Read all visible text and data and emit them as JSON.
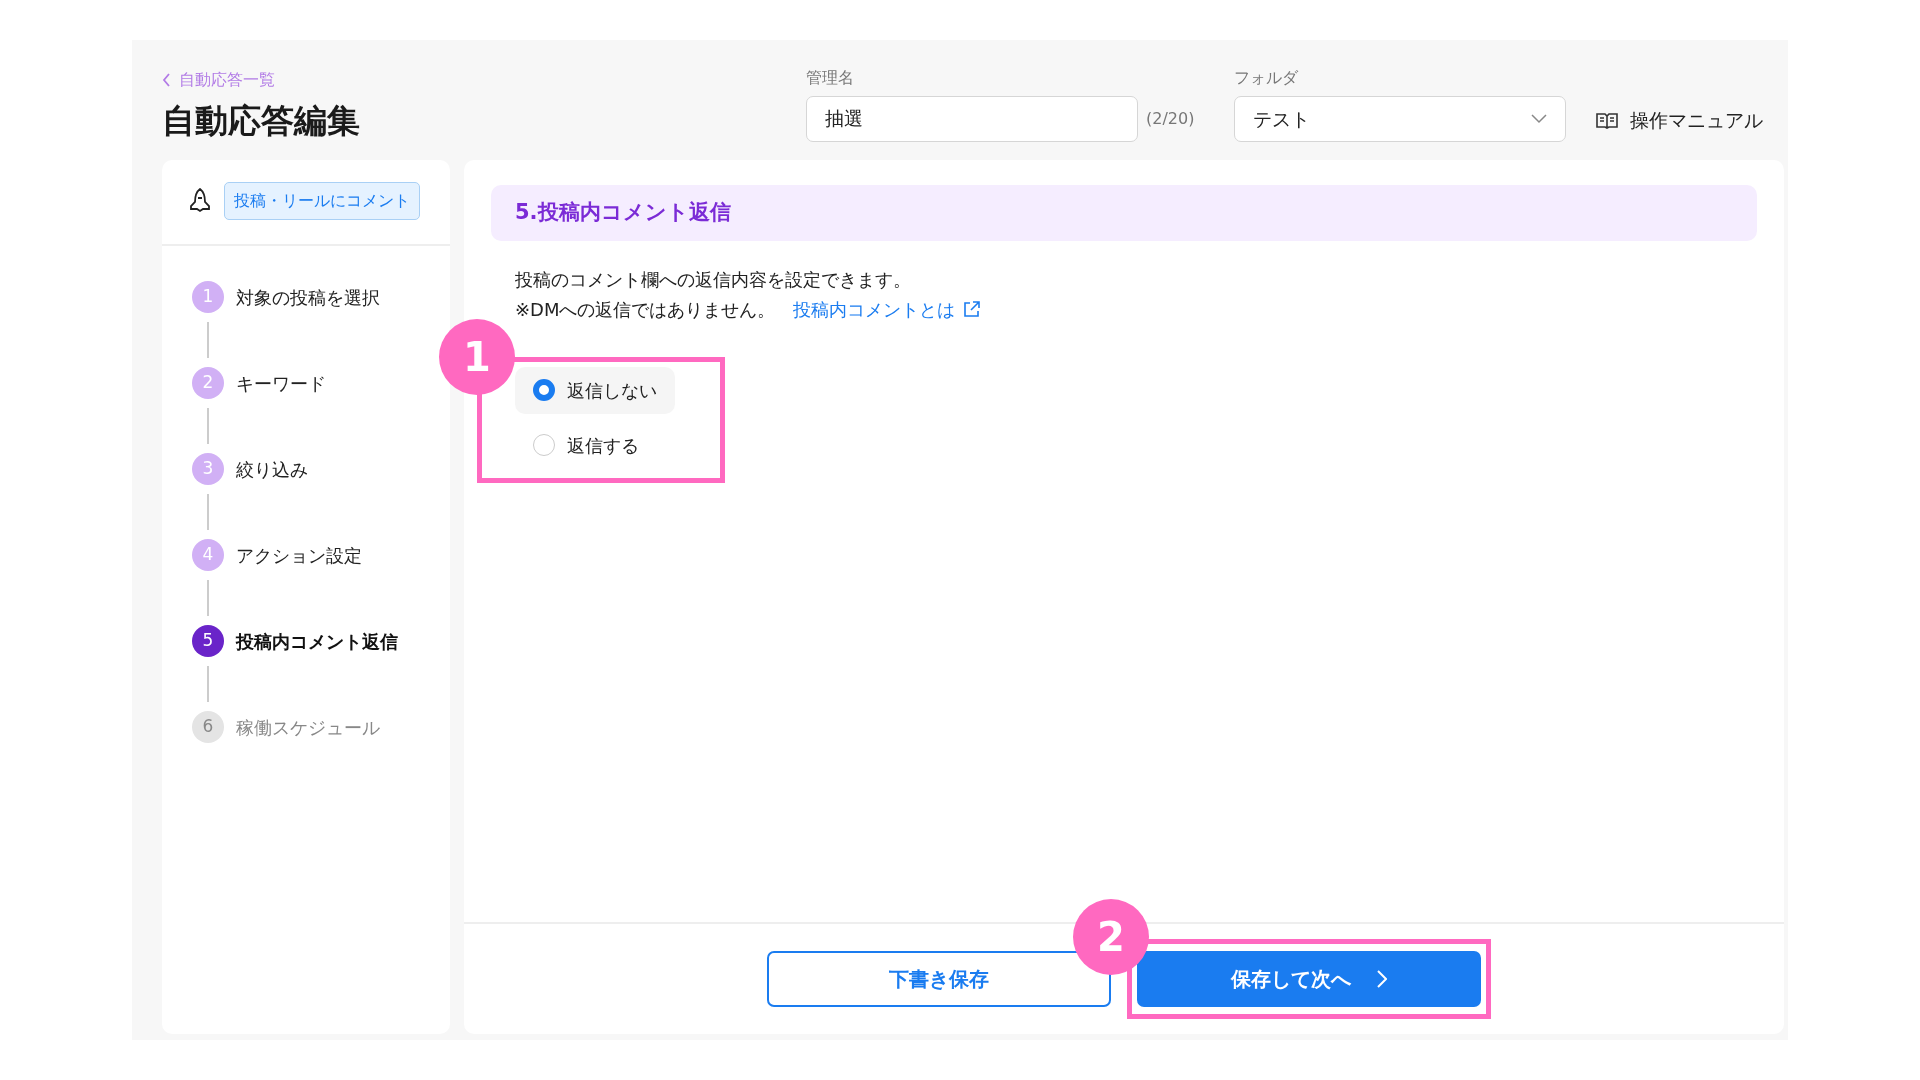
{
  "header": {
    "back_link": "自動応答一覧",
    "title": "自動応答編集",
    "name_field": {
      "label": "管理名",
      "value": "抽選",
      "counter": "(2/20)"
    },
    "folder_field": {
      "label": "フォルダ",
      "value": "テスト"
    },
    "manual_link": "操作マニュアル"
  },
  "sidebar": {
    "trigger_tag": "投稿・リールにコメント",
    "steps": [
      {
        "number": "1",
        "label": "対象の投稿を選択",
        "kind": "done"
      },
      {
        "number": "2",
        "label": "キーワード",
        "kind": "done"
      },
      {
        "number": "3",
        "label": "絞り込み",
        "kind": "done"
      },
      {
        "number": "4",
        "label": "アクション設定",
        "kind": "done"
      },
      {
        "number": "5",
        "label": "投稿内コメント返信",
        "kind": "current"
      },
      {
        "number": "6",
        "label": "稼働スケジュール",
        "kind": "upcoming"
      }
    ]
  },
  "section": {
    "heading": "5.投稿内コメント返信",
    "description": "投稿のコメント欄への返信内容を設定できます。",
    "note": "※DMへの返信ではありません。",
    "help_link": "投稿内コメントとは",
    "radio_annotation": "1",
    "options": [
      {
        "label": "返信しない",
        "selected": true
      },
      {
        "label": "返信する",
        "selected": false
      }
    ]
  },
  "footer": {
    "draft_button": "下書き保存",
    "next_button": "保存して次へ",
    "next_annotation": "2"
  }
}
